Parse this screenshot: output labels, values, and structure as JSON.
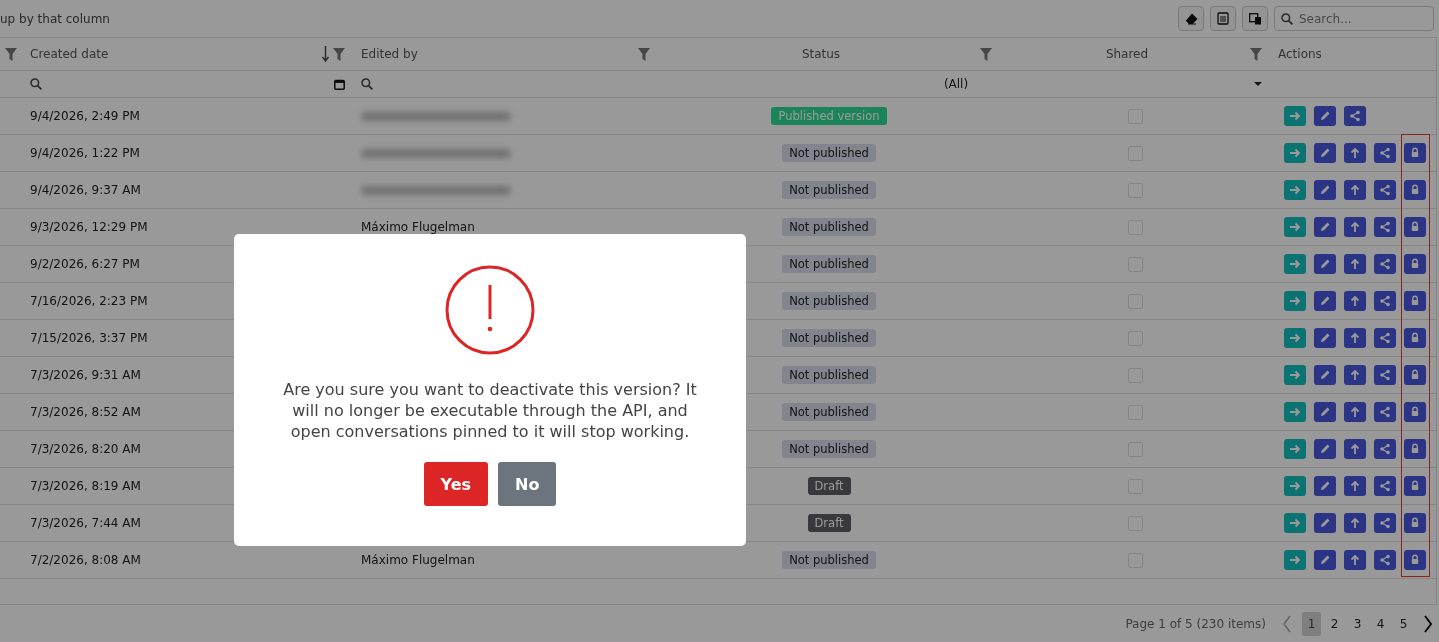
{
  "toolbar": {
    "group_hint": "up by that column",
    "search": {
      "placeholder": "Search..."
    }
  },
  "table": {
    "columns": [
      {
        "sorted": false,
        "filter": true
      },
      {
        "label": "Created date",
        "sorted": true,
        "filter": true
      },
      {
        "label": "Edited by",
        "sorted": false,
        "filter": true
      },
      {
        "label": "Status",
        "sorted": false,
        "filter": true
      },
      {
        "label": "Shared",
        "sorted": false,
        "filter": true
      },
      {
        "label": "Actions",
        "sorted": false,
        "filter": false
      }
    ],
    "filter_row": {
      "status_filter": "(All)"
    },
    "rows": [
      {
        "created": "9/4/2026, 2:49 PM",
        "edited_by": {
          "kind": "redacted"
        },
        "status": {
          "kind": "published",
          "label": "Published version"
        },
        "shared": false,
        "actions": [
          {
            "kind": "open"
          },
          {
            "kind": "edit"
          },
          {
            "kind": "share"
          }
        ]
      },
      {
        "created": "9/4/2026, 1:22 PM",
        "edited_by": {
          "kind": "redacted"
        },
        "status": {
          "kind": "unpublished",
          "label": "Not published"
        },
        "shared": false,
        "actions": [
          {
            "kind": "open"
          },
          {
            "kind": "edit"
          },
          {
            "kind": "publish"
          },
          {
            "kind": "share"
          },
          {
            "kind": "deactivate"
          }
        ]
      },
      {
        "created": "9/4/2026, 9:37 AM",
        "edited_by": {
          "kind": "redacted"
        },
        "status": {
          "kind": "unpublished",
          "label": "Not published"
        },
        "shared": false,
        "actions": [
          {
            "kind": "open"
          },
          {
            "kind": "edit"
          },
          {
            "kind": "publish"
          },
          {
            "kind": "share"
          },
          {
            "kind": "deactivate"
          }
        ]
      },
      {
        "created": "9/3/2026, 12:29 PM",
        "edited_by": {
          "kind": "text",
          "text": "Máximo Flugelman"
        },
        "status": {
          "kind": "unpublished",
          "label": "Not published"
        },
        "shared": false,
        "actions": [
          {
            "kind": "open"
          },
          {
            "kind": "edit"
          },
          {
            "kind": "publish"
          },
          {
            "kind": "share"
          },
          {
            "kind": "deactivate"
          }
        ]
      },
      {
        "created": "9/2/2026, 6:27 PM",
        "status": {
          "kind": "unpublished",
          "label": "Not published"
        },
        "shared": false,
        "actions": [
          {
            "kind": "open"
          },
          {
            "kind": "edit"
          },
          {
            "kind": "publish"
          },
          {
            "kind": "share"
          },
          {
            "kind": "deactivate"
          }
        ]
      },
      {
        "created": "7/16/2026, 2:23 PM",
        "status": {
          "kind": "unpublished",
          "label": "Not published"
        },
        "shared": false,
        "actions": [
          {
            "kind": "open"
          },
          {
            "kind": "edit"
          },
          {
            "kind": "publish"
          },
          {
            "kind": "share"
          },
          {
            "kind": "deactivate"
          }
        ]
      },
      {
        "created": "7/15/2026, 3:37 PM",
        "status": {
          "kind": "unpublished",
          "label": "Not published"
        },
        "shared": false,
        "actions": [
          {
            "kind": "open"
          },
          {
            "kind": "edit"
          },
          {
            "kind": "publish"
          },
          {
            "kind": "share"
          },
          {
            "kind": "deactivate"
          }
        ]
      },
      {
        "created": "7/3/2026, 9:31 AM",
        "status": {
          "kind": "unpublished",
          "label": "Not published"
        },
        "shared": false,
        "actions": [
          {
            "kind": "open"
          },
          {
            "kind": "edit"
          },
          {
            "kind": "publish"
          },
          {
            "kind": "share"
          },
          {
            "kind": "deactivate"
          }
        ]
      },
      {
        "created": "7/3/2026, 8:52 AM",
        "status": {
          "kind": "unpublished",
          "label": "Not published"
        },
        "shared": false,
        "actions": [
          {
            "kind": "open"
          },
          {
            "kind": "edit"
          },
          {
            "kind": "publish"
          },
          {
            "kind": "share"
          },
          {
            "kind": "deactivate"
          }
        ]
      },
      {
        "created": "7/3/2026, 8:20 AM",
        "status": {
          "kind": "unpublished",
          "label": "Not published"
        },
        "shared": false,
        "actions": [
          {
            "kind": "open"
          },
          {
            "kind": "edit"
          },
          {
            "kind": "publish"
          },
          {
            "kind": "share"
          },
          {
            "kind": "deactivate"
          }
        ]
      },
      {
        "created": "7/3/2026, 8:19 AM",
        "status": {
          "kind": "draft",
          "label": "Draft"
        },
        "shared": false,
        "actions": [
          {
            "kind": "open"
          },
          {
            "kind": "edit"
          },
          {
            "kind": "publish"
          },
          {
            "kind": "share"
          },
          {
            "kind": "deactivate"
          }
        ]
      },
      {
        "created": "7/3/2026, 7:44 AM",
        "status": {
          "kind": "draft",
          "label": "Draft"
        },
        "shared": false,
        "actions": [
          {
            "kind": "open"
          },
          {
            "kind": "edit"
          },
          {
            "kind": "publish"
          },
          {
            "kind": "share"
          },
          {
            "kind": "deactivate"
          }
        ]
      },
      {
        "created": "7/2/2026, 8:08 AM",
        "edited_by": {
          "kind": "text",
          "text": "Máximo Flugelman"
        },
        "status": {
          "kind": "unpublished",
          "label": "Not published"
        },
        "shared": false,
        "actions": [
          {
            "kind": "open"
          },
          {
            "kind": "edit"
          },
          {
            "kind": "publish"
          },
          {
            "kind": "share"
          },
          {
            "kind": "deactivate"
          }
        ]
      }
    ]
  },
  "pager": {
    "summary": "Page 1 of 5 (230 items)",
    "pages": [
      {
        "label": "1",
        "selected": true
      },
      {
        "label": "2",
        "selected": false
      },
      {
        "label": "3",
        "selected": false
      },
      {
        "label": "4",
        "selected": false
      },
      {
        "label": "5",
        "selected": false
      }
    ]
  },
  "dialog": {
    "message": "Are you sure you want to deactivate this version? It will no longer be executable through the API, and open conversations pinned to it will stop working.",
    "buttons": [
      {
        "label": "Yes",
        "kind": "primary"
      },
      {
        "label": "No",
        "kind": "secondary"
      }
    ]
  }
}
